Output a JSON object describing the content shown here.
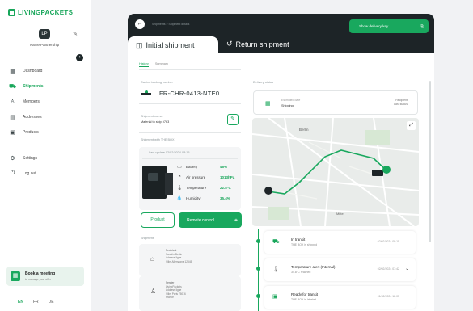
{
  "brand": {
    "name": "LIVINGPACKETS"
  },
  "partner": {
    "name": "Name Partnership",
    "initials": "LP"
  },
  "nav": [
    {
      "label": "Dashboard",
      "icon": "grid-icon",
      "active": false
    },
    {
      "label": "Shipments",
      "icon": "truck-icon",
      "active": true
    },
    {
      "label": "Members",
      "icon": "user-icon",
      "active": false
    },
    {
      "label": "Addresses",
      "icon": "address-book-icon",
      "active": false
    },
    {
      "label": "Products",
      "icon": "box-icon",
      "active": false
    },
    {
      "label": "Settings",
      "icon": "gear-icon",
      "active": false
    },
    {
      "label": "Log out",
      "icon": "power-icon",
      "active": false
    }
  ],
  "meeting": {
    "title": "Book a meeting",
    "subtitle": "to manage your offer"
  },
  "languages": [
    "EN",
    "FR",
    "DE"
  ],
  "header": {
    "breadcrumb": "Shipments > Shipment details",
    "show_key": "Show delivery key"
  },
  "tabs": {
    "initial": "Initial shipment",
    "return": "Return shipment"
  },
  "subtabs": [
    "History",
    "Summary"
  ],
  "tracking": {
    "label": "Carrier tracking number",
    "number": "FR-CHR-0413-NTE0"
  },
  "shipment_name": {
    "label": "Shipment name",
    "value": "Material to ship #763"
  },
  "box": {
    "section_label": "Shipment with THE BOX",
    "last_update": "Last update 02/02/2024 08:15",
    "box_id": "",
    "stats": [
      {
        "label": "Battery",
        "value": "46%",
        "icon": "battery-icon"
      },
      {
        "label": "Air pressure",
        "value": "1013hPa",
        "icon": "gauge-icon"
      },
      {
        "label": "Temperature",
        "value": "22.8°C",
        "icon": "thermometer-icon"
      },
      {
        "label": "Humidity",
        "value": "35.4%",
        "icon": "droplet-icon"
      }
    ]
  },
  "buttons": {
    "product": "Product",
    "remote": "Remote control"
  },
  "addresses": {
    "label": "Shipment",
    "sender": {
      "role": "Recipient",
      "name": "Sandrin Bertin",
      "lines": [
        "Adresse ligne",
        "Ville, Allemagne 12345"
      ]
    },
    "receiver": {
      "role": "Sender",
      "name": "LivingPackets",
      "lines": [
        "Address ligne",
        "Ville, Paris 75016",
        "France"
      ]
    }
  },
  "delivery": {
    "label": "Delivery status",
    "status_label": "Estimated date",
    "status_value": "Shipping",
    "right_top": "Recipient",
    "right_bottom": "Last status"
  },
  "map": {
    "labels": [
      "Berlin",
      "Mitte"
    ]
  },
  "events": [
    {
      "title": "In transit",
      "subtitle": "THE BOX is shipped",
      "date": "02/02/2024 08:15",
      "icon": "truck-icon"
    },
    {
      "title": "Temperature alert (Internal)",
      "subtitle": "34.8°C reached",
      "date": "02/02/2024 07:42",
      "icon": "thermometer-icon"
    },
    {
      "title": "Ready for transit",
      "subtitle": "THE BOX is labeled",
      "date": "01/02/2024 18:05",
      "icon": "box-icon"
    }
  ]
}
